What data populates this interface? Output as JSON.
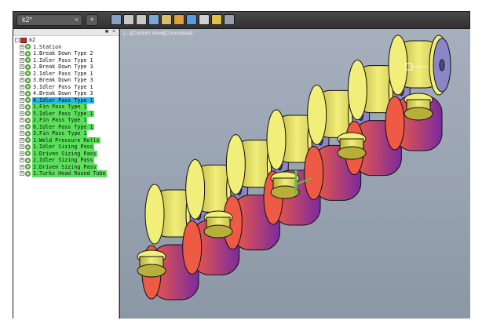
{
  "document": {
    "tab_title": "k2*",
    "tab_close": "×",
    "new_tab": "+"
  },
  "toolbar": {
    "buttons": [
      {
        "name": "view-cube-icon",
        "color": "#8a9fc7"
      },
      {
        "name": "pan-icon",
        "color": "#c8c8c8"
      },
      {
        "name": "zoom-icon",
        "color": "#c8c8c8"
      },
      {
        "name": "orbit-icon",
        "color": "#7aa7d8"
      },
      {
        "name": "render-icon",
        "color": "#d8c06a"
      },
      {
        "name": "import-icon",
        "color": "#e0a040"
      },
      {
        "name": "export-icon",
        "color": "#5a9ae0"
      },
      {
        "name": "layers-icon",
        "color": "#d0d0d0"
      },
      {
        "name": "settings-icon",
        "color": "#e0c040"
      },
      {
        "name": "help-icon",
        "color": "#9aa0aa"
      }
    ]
  },
  "panel": {
    "pin": "■",
    "close": "×"
  },
  "tree": {
    "expanders": {
      "collapsed": "+",
      "expanded": "-"
    },
    "root": {
      "label": "k2"
    },
    "items": [
      {
        "label": "1.Station",
        "style": "plain"
      },
      {
        "label": "1.Break Down Type  2",
        "style": "plain"
      },
      {
        "label": "1.Idler Pass Type  1",
        "style": "plain"
      },
      {
        "label": "2.Break Down Type  3",
        "style": "plain"
      },
      {
        "label": "2.Idler Pass Type  1",
        "style": "plain"
      },
      {
        "label": "3.Break Down Type  3",
        "style": "plain"
      },
      {
        "label": "3.Idler Pass Type  1",
        "style": "plain"
      },
      {
        "label": "4.Break Down Type  3",
        "style": "plain"
      },
      {
        "label": "4.Idler Pass Type  1",
        "style": "selected"
      },
      {
        "label": "1.Fin Pass   Type  1",
        "style": "green"
      },
      {
        "label": "5.Idler Pass Type  1",
        "style": "green"
      },
      {
        "label": "2.Fin Pass   Type  1",
        "style": "green"
      },
      {
        "label": "6.Idler Pass Type  1",
        "style": "green"
      },
      {
        "label": "3.Fin Pass   Type  1",
        "style": "green"
      },
      {
        "label": "1.Weld Pressure Rolls",
        "style": "green"
      },
      {
        "label": "1.Idler  Sizing Pass",
        "style": "green"
      },
      {
        "label": "1.Driven Sizing Pass",
        "style": "green"
      },
      {
        "label": "2.Idler  Sizing Pass",
        "style": "green"
      },
      {
        "label": "2.Driven Sizing Pass",
        "style": "green"
      },
      {
        "label": "1.Turks Head Round Tube",
        "style": "green"
      }
    ]
  },
  "viewport": {
    "label": "[—][Custom View][Conceptual]",
    "colors": {
      "roll_yellow": "#f2ee7a",
      "roll_yellow_dark": "#b8ae3a",
      "disk_blue": "#8a86c8",
      "disk_blue_dark": "#4f4a8a",
      "bottom_red": "#ee5a44",
      "bottom_purple": "#7a2aa0",
      "tube_green": "#58c058"
    }
  }
}
